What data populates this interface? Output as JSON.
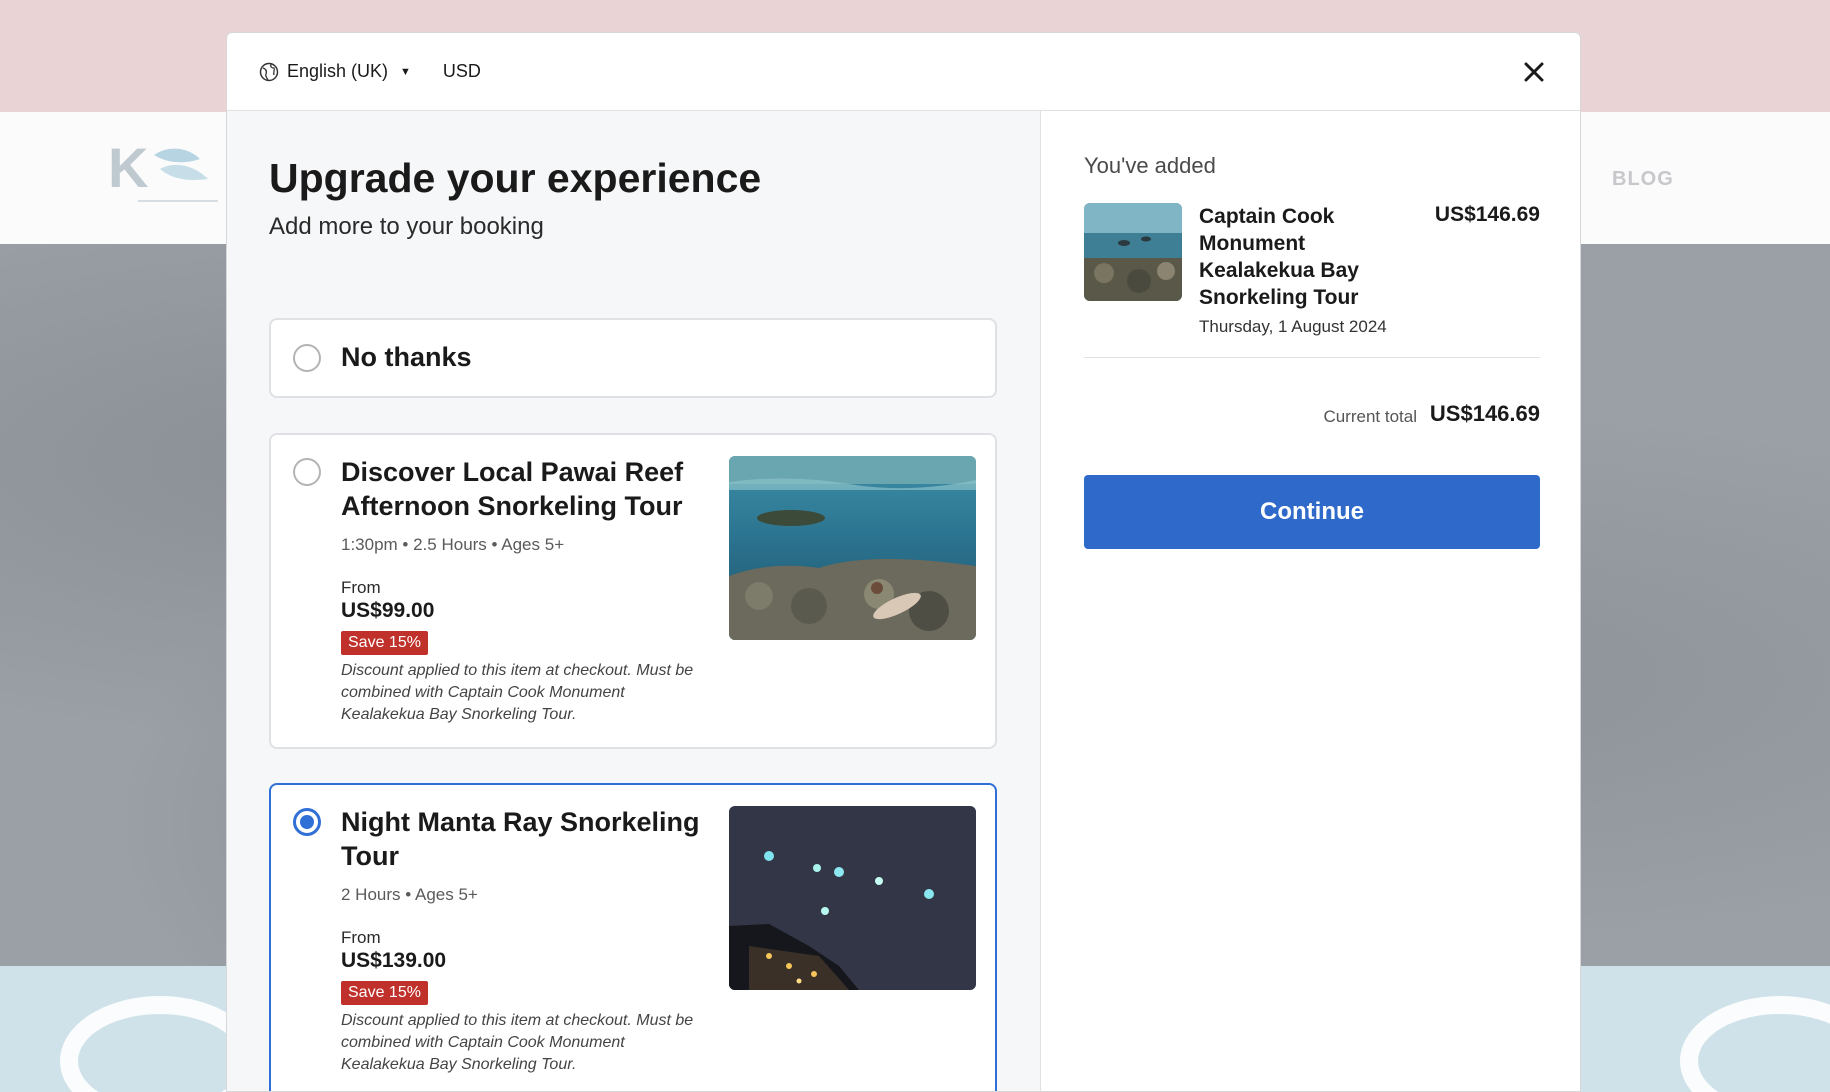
{
  "background": {
    "nav_item": "BLOG"
  },
  "header": {
    "language": "English (UK)",
    "currency": "USD"
  },
  "main": {
    "title": "Upgrade your experience",
    "subtitle": "Add more to your booking",
    "no_thanks_label": "No thanks",
    "options": [
      {
        "title": "Discover Local Pawai Reef Afternoon Snorkeling Tour",
        "meta": "1:30pm • 2.5 Hours • Ages 5+",
        "from_label": "From",
        "price": "US$99.00",
        "badge": "Save 15%",
        "note": "Discount applied to this item at checkout. Must be combined with Captain Cook Monument Kealakekua Bay Snorkeling Tour.",
        "selected": false
      },
      {
        "title": "Night Manta Ray Snorkeling Tour",
        "meta": "2 Hours • Ages 5+",
        "from_label": "From",
        "price": "US$139.00",
        "badge": "Save 15%",
        "note": "Discount applied to this item at checkout. Must be combined with Captain Cook Monument Kealakekua Bay Snorkeling Tour.",
        "selected": true
      }
    ]
  },
  "summary": {
    "added_label": "You've added",
    "item_name": "Captain Cook Monument Kealakekua Bay Snorkeling Tour",
    "item_price": "US$146.69",
    "item_date": "Thursday, 1 August 2024",
    "total_label": "Current total",
    "total_value": "US$146.69",
    "continue_label": "Continue"
  },
  "colors": {
    "accent": "#2f6fd6",
    "button": "#2f6acb",
    "badge": "#c0312b"
  }
}
